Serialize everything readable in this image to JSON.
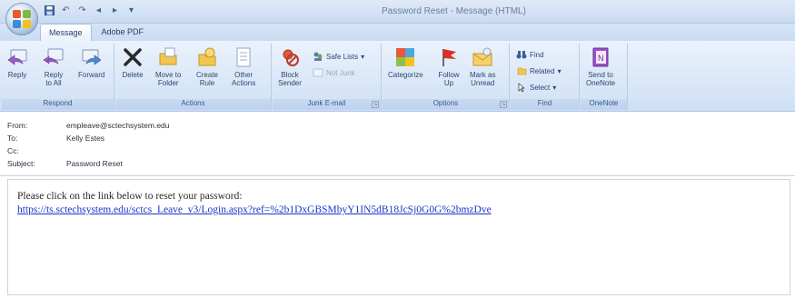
{
  "window": {
    "title": "Password Reset - Message (HTML)"
  },
  "quick_access": {
    "icons": [
      "save-icon",
      "undo-icon",
      "redo-icon",
      "previous-icon",
      "next-icon",
      "customize-icon"
    ]
  },
  "tabs": [
    {
      "label": "Message",
      "active": true
    },
    {
      "label": "Adobe PDF",
      "active": false
    }
  ],
  "ribbon": {
    "respond": {
      "label": "Respond",
      "buttons": [
        {
          "label": "Reply",
          "icon": "reply-icon"
        },
        {
          "label": "Reply\nto All",
          "icon": "reply-all-icon"
        },
        {
          "label": "Forward",
          "icon": "forward-icon"
        }
      ]
    },
    "actions": {
      "label": "Actions",
      "buttons": [
        {
          "label": "Delete",
          "icon": "delete-icon"
        },
        {
          "label": "Move to\nFolder",
          "icon": "move-folder-icon"
        },
        {
          "label": "Create\nRule",
          "icon": "create-rule-icon"
        },
        {
          "label": "Other\nActions",
          "icon": "other-actions-icon"
        }
      ]
    },
    "junk": {
      "label": "Junk E-mail",
      "block_label": "Block\nSender",
      "safe_lists_label": "Safe Lists",
      "not_junk_label": "Not Junk"
    },
    "options": {
      "label": "Options",
      "buttons": [
        {
          "label": "Categorize",
          "icon": "categorize-icon"
        },
        {
          "label": "Follow\nUp",
          "icon": "follow-up-flag-icon"
        },
        {
          "label": "Mark as\nUnread",
          "icon": "mark-unread-icon"
        }
      ]
    },
    "find": {
      "label": "Find",
      "find_label": "Find",
      "related_label": "Related",
      "select_label": "Select"
    },
    "onenote": {
      "label": "OneNote",
      "send_label": "Send to\nOneNote"
    }
  },
  "message": {
    "from_label": "From:",
    "from_value": "empleave@sctechsystem.edu",
    "to_label": "To:",
    "to_value": "Kelly Estes",
    "cc_label": "Cc:",
    "cc_value": "",
    "subject_label": "Subject:",
    "subject_value": "Password Reset",
    "body_text": "Please click on the link below to reset your password:",
    "link_text": "https://ts.sctechsystem.edu/sctcs_Leave_v3/Login.aspx?ref=%2b1DxGBSMbyY1IN5dB18JcSj0G0G%2bmzDve"
  },
  "colors": {
    "ribbon_bg": "#dbe8f8",
    "link": "#1a35c7",
    "group_label": "#3c5a86"
  }
}
